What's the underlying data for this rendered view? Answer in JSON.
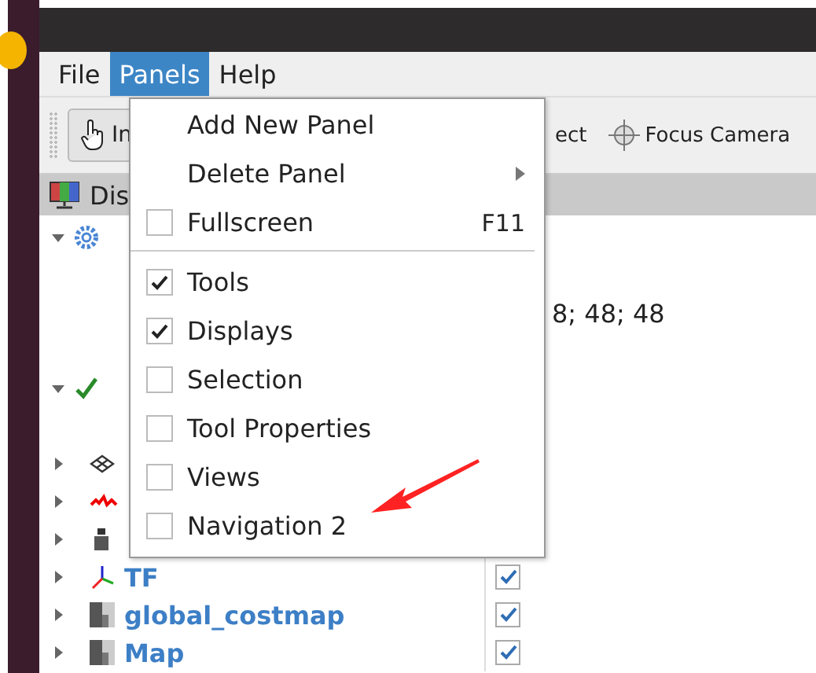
{
  "menubar": [
    {
      "label": "File",
      "selected": false
    },
    {
      "label": "Panels",
      "selected": true
    },
    {
      "label": "Help",
      "selected": false
    }
  ],
  "toolbar": [
    {
      "kind": "interact",
      "label": "In"
    },
    {
      "kind": "select",
      "label": "ect"
    },
    {
      "kind": "focus",
      "label": "Focus Camera"
    }
  ],
  "panel": {
    "title": "Dis"
  },
  "tree": {
    "rows": [
      {
        "kind": "options",
        "expanded": true
      },
      {
        "kind": "blank"
      },
      {
        "kind": "value",
        "value": "8; 48; 48"
      },
      {
        "kind": "blank"
      },
      {
        "kind": "status",
        "expanded": true
      },
      {
        "kind": "blank"
      },
      {
        "kind": "grid",
        "expanded": false
      },
      {
        "kind": "path",
        "expanded": false
      },
      {
        "kind": "robot",
        "expanded": false
      },
      {
        "kind": "tf",
        "name": "TF",
        "expanded": false,
        "checked": true
      },
      {
        "kind": "costmap",
        "name": "global_costmap",
        "expanded": false,
        "checked": true
      },
      {
        "kind": "map",
        "name": "Map",
        "expanded": false,
        "checked": true
      }
    ]
  },
  "panels_menu": {
    "items": [
      {
        "kind": "action",
        "label": "Add New Panel"
      },
      {
        "kind": "submenu",
        "label": "Delete Panel"
      },
      {
        "kind": "check",
        "label": "Fullscreen",
        "checked": false,
        "shortcut": "F11"
      },
      {
        "kind": "separator"
      },
      {
        "kind": "check",
        "label": "Tools",
        "checked": true
      },
      {
        "kind": "check",
        "label": "Displays",
        "checked": true
      },
      {
        "kind": "check",
        "label": "Selection",
        "checked": false
      },
      {
        "kind": "check",
        "label": "Tool Properties",
        "checked": false
      },
      {
        "kind": "check",
        "label": "Views",
        "checked": false
      },
      {
        "kind": "check",
        "label": "Navigation 2",
        "checked": false
      }
    ]
  }
}
